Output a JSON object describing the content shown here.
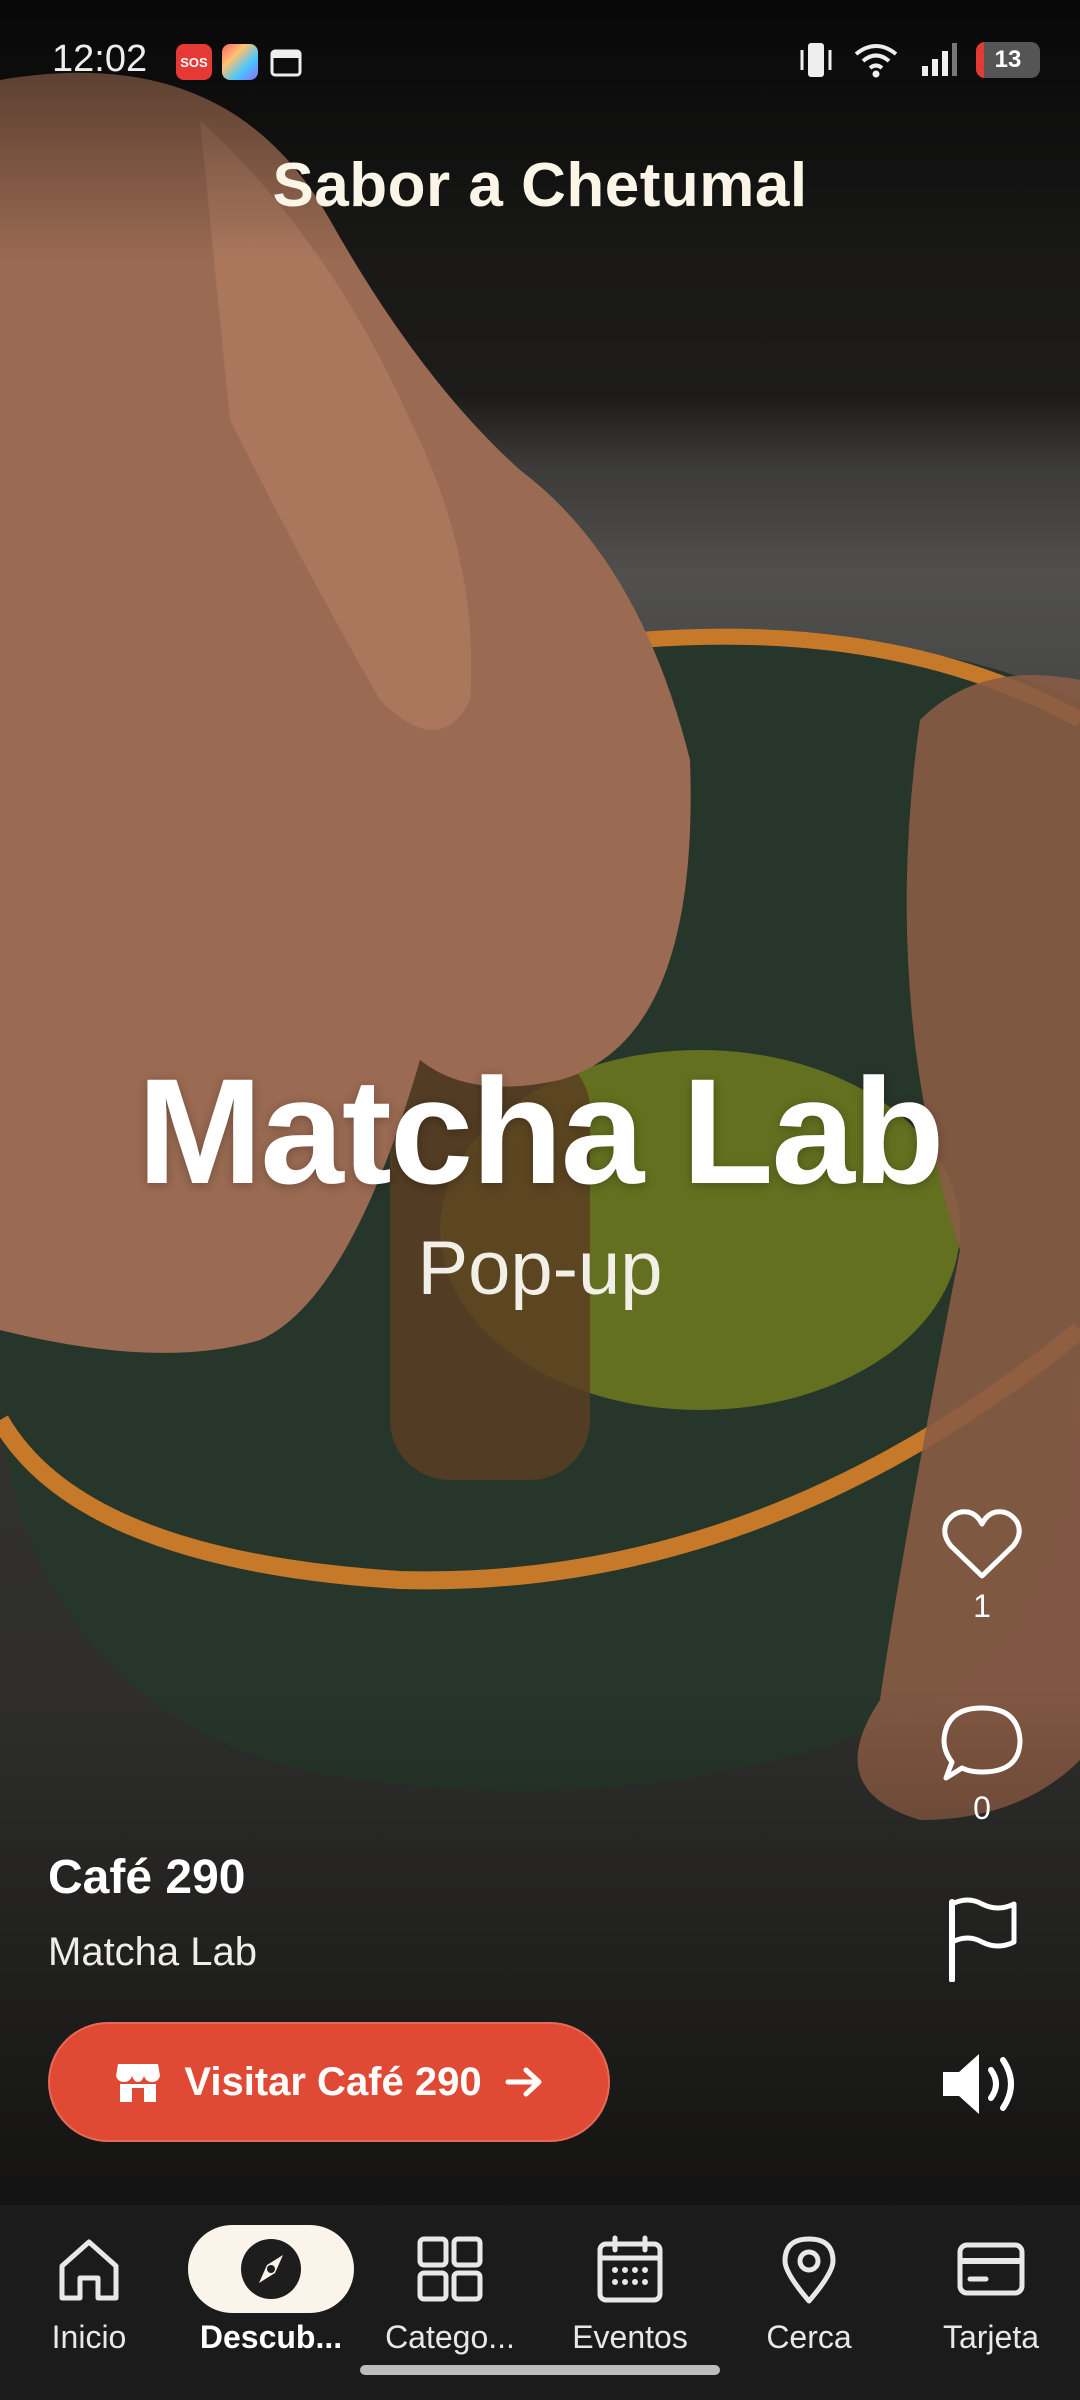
{
  "status_bar": {
    "time": "12:02",
    "sos_label": "SOS",
    "battery_level": "13",
    "battery_fraction": 0.13,
    "icons": [
      "sos-icon",
      "app-star-icon",
      "calendar-icon",
      "vibrate-icon",
      "wifi-icon",
      "signal-icon",
      "battery-icon"
    ]
  },
  "header": {
    "title": "Sabor a Chetumal"
  },
  "video": {
    "overlay_title": "Matcha Lab",
    "overlay_subtitle": "Pop-up"
  },
  "actions": {
    "like_count": "1",
    "comment_count": "0",
    "icons": [
      "heart-icon",
      "comment-icon",
      "flag-icon",
      "volume-icon"
    ]
  },
  "business": {
    "name": "Café 290",
    "item": "Matcha Lab",
    "visit_button_label": "Visitar Café 290",
    "icons": [
      "store-icon",
      "arrow-right-icon"
    ]
  },
  "bottom_nav": {
    "items": [
      {
        "label": "Inicio",
        "icon": "home-icon"
      },
      {
        "label": "Descub...",
        "icon": "compass-icon",
        "active": true
      },
      {
        "label": "Catego...",
        "icon": "grid-icon"
      },
      {
        "label": "Eventos",
        "icon": "calendar-icon"
      },
      {
        "label": "Cerca",
        "icon": "location-pin-icon"
      },
      {
        "label": "Tarjeta",
        "icon": "card-icon"
      }
    ]
  },
  "colors": {
    "accent_button": "#e04a34",
    "active_pill": "#fbf4ea",
    "title_cream": "#fbf5e8",
    "nav_background": "#1b1b1b"
  }
}
